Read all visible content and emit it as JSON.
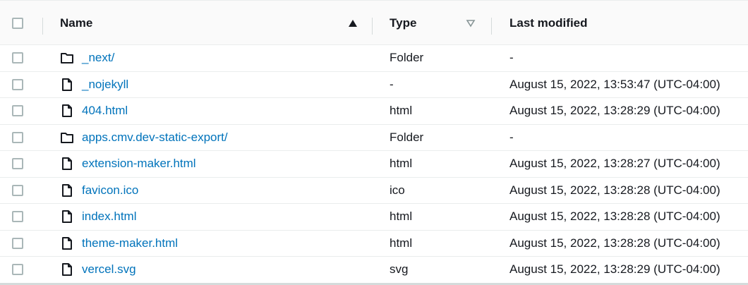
{
  "header": {
    "name_label": "Name",
    "type_label": "Type",
    "modified_label": "Last modified"
  },
  "rows": [
    {
      "name": "_next/",
      "kind": "folder",
      "type": "Folder",
      "modified": "-"
    },
    {
      "name": "_nojekyll",
      "kind": "file",
      "type": "-",
      "modified": "August 15, 2022, 13:53:47 (UTC-04:00)"
    },
    {
      "name": "404.html",
      "kind": "file",
      "type": "html",
      "modified": "August 15, 2022, 13:28:29 (UTC-04:00)"
    },
    {
      "name": "apps.cmv.dev-static-export/",
      "kind": "folder",
      "type": "Folder",
      "modified": "-"
    },
    {
      "name": "extension-maker.html",
      "kind": "file",
      "type": "html",
      "modified": "August 15, 2022, 13:28:27 (UTC-04:00)"
    },
    {
      "name": "favicon.ico",
      "kind": "file",
      "type": "ico",
      "modified": "August 15, 2022, 13:28:28 (UTC-04:00)"
    },
    {
      "name": "index.html",
      "kind": "file",
      "type": "html",
      "modified": "August 15, 2022, 13:28:28 (UTC-04:00)"
    },
    {
      "name": "theme-maker.html",
      "kind": "file",
      "type": "html",
      "modified": "August 15, 2022, 13:28:28 (UTC-04:00)"
    },
    {
      "name": "vercel.svg",
      "kind": "file",
      "type": "svg",
      "modified": "August 15, 2022, 13:28:29 (UTC-04:00)"
    }
  ],
  "colors": {
    "link": "#0073bb",
    "header_bg": "#fafafa",
    "border": "#eaeded"
  },
  "icons": {
    "folder": "folder-icon",
    "file": "file-icon",
    "sort_asc": "sort-ascending-icon",
    "sort_none": "sort-unsorted-icon"
  }
}
